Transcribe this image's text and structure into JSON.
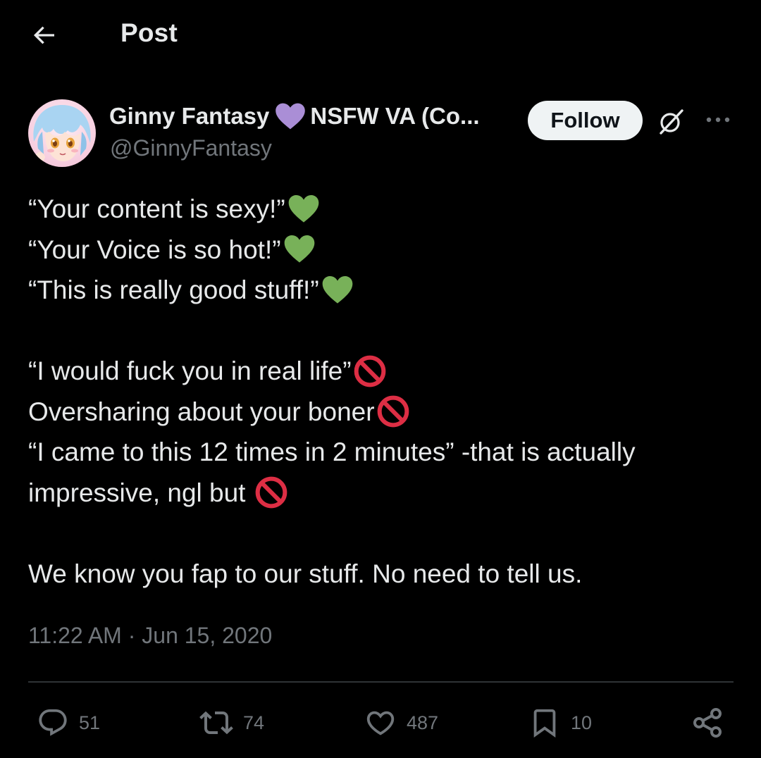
{
  "header": {
    "title": "Post",
    "back_icon": "arrow-left-icon"
  },
  "author": {
    "display_name": "Ginny Fantasy",
    "name_suffix": "NSFW VA (Co...",
    "name_emoji": "purple-heart-icon",
    "handle": "@GinnyFantasy",
    "avatar": "anime-girl-avatar"
  },
  "actions_top": {
    "follow_label": "Follow",
    "grok_icon": "grok-icon",
    "more_icon": "more-horizontal-icon"
  },
  "tweet": {
    "lines": [
      "“Your content is sexy!”",
      "“Your Voice is so hot!”",
      "“This is really good stuff!”",
      "",
      "“I would fuck you in real life”",
      "Oversharing about your boner",
      "“I came to this 12 times in 2 minutes” -that is actually",
      "impressive, ngl but ",
      "",
      "We know you fap to our stuff. No need to tell us."
    ],
    "line_emojis": [
      "green-heart-icon",
      "green-heart-icon",
      "green-heart-icon",
      "",
      "prohibited-icon",
      "prohibited-icon",
      "",
      "prohibited-icon",
      "",
      ""
    ],
    "timestamp": "11:22 AM · Jun 15, 2020"
  },
  "engagement": {
    "replies": "51",
    "reposts": "74",
    "likes": "487",
    "bookmarks": "10",
    "icons": [
      "reply-icon",
      "repost-icon",
      "like-icon",
      "bookmark-icon",
      "share-icon"
    ]
  },
  "colors": {
    "background": "#000000",
    "text_primary": "#e7e9ea",
    "text_secondary": "#71767b",
    "divider": "#2f3336",
    "follow_bg": "#eff3f4",
    "green_heart": "#78b159",
    "purple_heart": "#aa8ed6",
    "prohibited": "#dd2e44"
  }
}
